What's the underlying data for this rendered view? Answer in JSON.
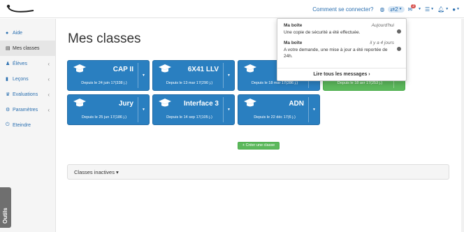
{
  "topbar": {
    "login_link": "Comment se connecter?",
    "messages_count": "2",
    "mail_badge": "2"
  },
  "sidebar": {
    "items": [
      {
        "label": "Aide",
        "icon": "help-circle-icon"
      },
      {
        "label": "Mes classes",
        "icon": "list-icon"
      },
      {
        "label": "Élèves",
        "icon": "users-icon",
        "chevron": "‹"
      },
      {
        "label": "Leçons",
        "icon": "book-icon",
        "chevron": "‹"
      },
      {
        "label": "Evaluations",
        "icon": "trophy-icon",
        "chevron": "‹"
      },
      {
        "label": "Paramètres",
        "icon": "gears-icon",
        "chevron": "‹"
      },
      {
        "label": "Eteindre",
        "icon": "power-icon"
      }
    ],
    "tools_label": "Outils"
  },
  "main": {
    "title": "Mes classes",
    "classes": [
      {
        "name": "CAP II",
        "since": "Depuis le 24 juin 17(338 j.)"
      },
      {
        "name": "6X41 LLV",
        "since": "Depuis le 13 mar 17(290 j.)"
      },
      {
        "name": "",
        "since": "Depuis le 18 mar 17(286 j.)"
      },
      {
        "name": "",
        "since": "Depuis le 18 avr 17(253 j.)"
      },
      {
        "name": "Jury",
        "since": "Depuis le 25 jun 17(186 j.)"
      },
      {
        "name": "Interface 3",
        "since": "Depuis le 14 sep 17(105 j.)"
      },
      {
        "name": "ADN",
        "since": "Depuis le 22 déc 17(6 j.)"
      }
    ],
    "create_button": "+ Créer une classe",
    "inactive_label": "Classes inactives ▾"
  },
  "notifications": {
    "messages": [
      {
        "from": "Ma boîte",
        "time": "Aujourd'hui",
        "text": "Une copie de sécurité a été effectuée."
      },
      {
        "from": "Ma boîte",
        "time": "il y a 4 jours",
        "text": "A votre demande, une mise à jour a été reportée de 24h."
      }
    ],
    "footer": "Lire tous les messages ›"
  },
  "colors": {
    "primary": "#2a7fc0",
    "success": "#5cb85c",
    "link": "#2a6fb0"
  }
}
